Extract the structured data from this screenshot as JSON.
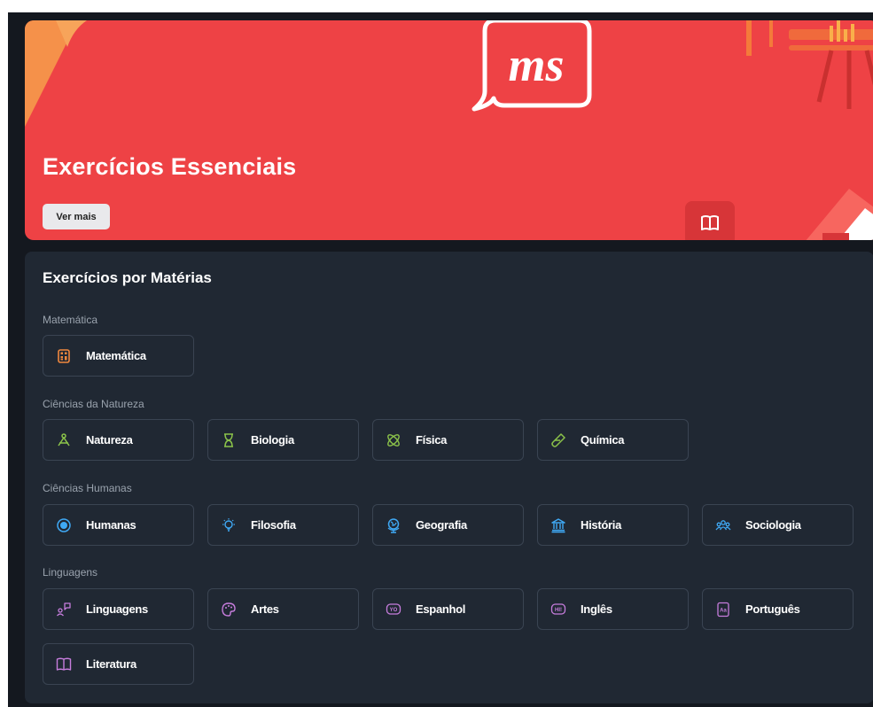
{
  "banner": {
    "title": "Exercícios Essenciais",
    "button_label": "Ver mais",
    "logo_text": "ms",
    "color": "#ee4245"
  },
  "panel": {
    "title": "Exercícios por Matérias",
    "groups": [
      {
        "label": "Matemática",
        "items": [
          {
            "label": "Matemática",
            "icon": "calculator-icon",
            "color": "#f0883e"
          }
        ]
      },
      {
        "label": "Ciências da Natureza",
        "items": [
          {
            "label": "Natureza",
            "icon": "atom-icon",
            "color": "#8bc34a"
          },
          {
            "label": "Biologia",
            "icon": "hourglass-icon",
            "color": "#8bc34a"
          },
          {
            "label": "Física",
            "icon": "orbit-icon",
            "color": "#8bc34a"
          },
          {
            "label": "Química",
            "icon": "test-tube-icon",
            "color": "#8bc34a"
          }
        ]
      },
      {
        "label": "Ciências Humanas",
        "items": [
          {
            "label": "Humanas",
            "icon": "target-icon",
            "color": "#3fa9f5"
          },
          {
            "label": "Filosofia",
            "icon": "lightbulb-icon",
            "color": "#3fa9f5"
          },
          {
            "label": "Geografia",
            "icon": "globe-icon",
            "color": "#3fa9f5"
          },
          {
            "label": "História",
            "icon": "museum-icon",
            "color": "#3fa9f5"
          },
          {
            "label": "Sociologia",
            "icon": "people-icon",
            "color": "#3fa9f5"
          }
        ]
      },
      {
        "label": "Linguagens",
        "items": [
          {
            "label": "Linguagens",
            "icon": "speech-person-icon",
            "color": "#c77ddd"
          },
          {
            "label": "Artes",
            "icon": "palette-icon",
            "color": "#c77ddd"
          },
          {
            "label": "Espanhol",
            "icon": "yo-bubble-icon",
            "color": "#c77ddd"
          },
          {
            "label": "Inglês",
            "icon": "hi-bubble-icon",
            "color": "#c77ddd"
          },
          {
            "label": "Português",
            "icon": "letters-book-icon",
            "color": "#c77ddd"
          },
          {
            "label": "Literatura",
            "icon": "open-book-icon",
            "color": "#c77ddd"
          }
        ]
      }
    ]
  }
}
